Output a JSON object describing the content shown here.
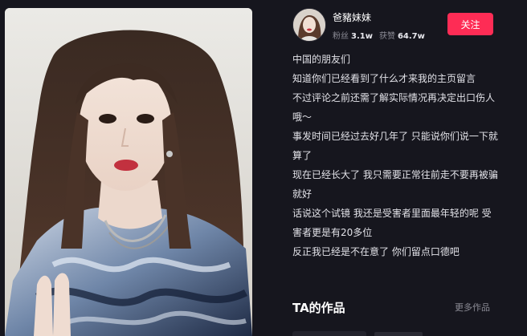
{
  "author": {
    "name": "爸豬妹妹",
    "fans_label": "粉丝",
    "fans_count": "3.1w",
    "likes_label": "获赞",
    "likes_count": "64.7w",
    "follow_label": "关注"
  },
  "caption": {
    "lines": [
      "中国的朋友们",
      "知道你们已经看到了什么才来我的主页留言",
      "不过评论之前还需了解实际情况再决定出口伤人",
      "哦～",
      "事发时间已经过去好几年了 只能说你们说一下就",
      "算了",
      "现在已经长大了 我只需要正常往前走不要再被骗",
      "就好",
      "话说这个试镜 我还是受害者里面最年轻的呢 受",
      "害者更是有20多位",
      "反正我已经是不在意了 你们留点口德吧"
    ]
  },
  "works": {
    "title": "TA的作品",
    "more_label": "更多作品"
  },
  "colors": {
    "background": "#16161e",
    "accent": "#fe2c55",
    "muted": "#8b8b95"
  },
  "icons": {
    "avatar": "profile-photo",
    "media": "portrait-photo"
  }
}
